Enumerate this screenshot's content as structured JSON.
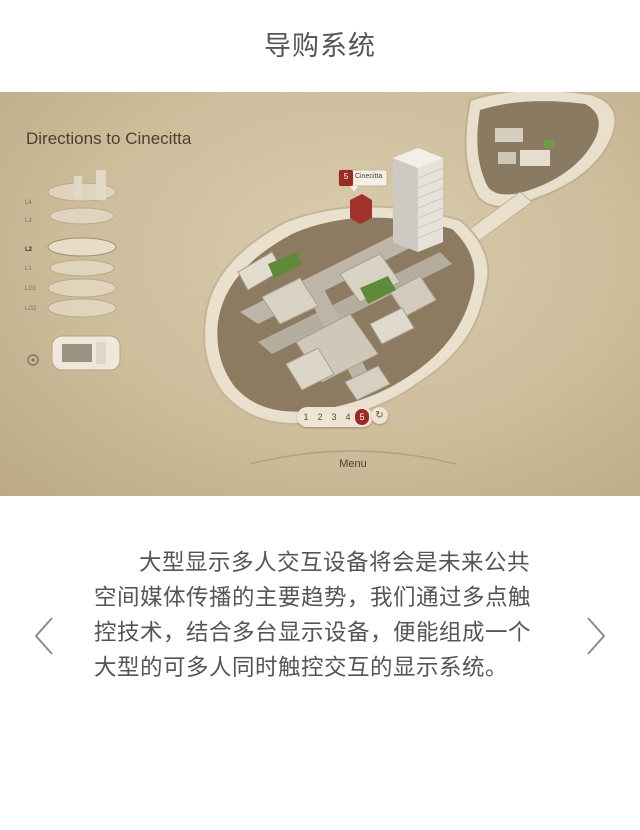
{
  "page": {
    "title": "导购系统"
  },
  "screen": {
    "map_title": "Directions to Cinecitta",
    "floors": [
      {
        "label": "L4",
        "active": false
      },
      {
        "label": "L3",
        "active": false
      },
      {
        "label": "L2",
        "active": true
      },
      {
        "label": "L1",
        "active": false
      },
      {
        "label": "LG1",
        "active": false
      },
      {
        "label": "LG2",
        "active": false
      }
    ],
    "destination": {
      "number": "5",
      "name": "Cinecitta"
    },
    "steps": [
      "1",
      "2",
      "3",
      "4",
      "5"
    ],
    "active_step": "5",
    "reset_icon": "refresh-icon",
    "menu_label": "Menu",
    "colors": {
      "background": "#cdbd9b",
      "accent": "#9b2a22",
      "park": "#5f8a3a"
    }
  },
  "description": {
    "text": "大型显示多人交互设备将会是未来公共空间媒体传播的主要趋势，我们通过多点触控技术，结合多台显示设备，便能组成一个大型的可多人同时触控交互的显示系统。"
  },
  "navigation": {
    "prev_icon": "chevron-left-icon",
    "next_icon": "chevron-right-icon"
  }
}
